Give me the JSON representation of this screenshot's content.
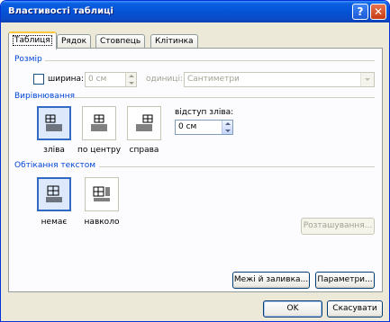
{
  "window": {
    "title": "Властивості таблиці"
  },
  "titlebar": {
    "help_glyph": "?",
    "close_glyph": "✕"
  },
  "tabs": [
    {
      "label": "Таблиця",
      "active": true
    },
    {
      "label": "Рядок",
      "active": false
    },
    {
      "label": "Стовпець",
      "active": false
    },
    {
      "label": "Клітинка",
      "active": false
    }
  ],
  "size": {
    "group": "Розмір",
    "width_label": "ширина:",
    "width_value": "0 см",
    "units_label": "одиниці:",
    "units_value": "Сантиметри"
  },
  "alignment": {
    "group": "Вирівнювання",
    "options": [
      {
        "label": "зліва",
        "selected": true
      },
      {
        "label": "по центру",
        "selected": false
      },
      {
        "label": "справа",
        "selected": false
      }
    ],
    "indent_label": "відступ зліва:",
    "indent_value": "0 см"
  },
  "wrapping": {
    "group": "Обтікання текстом",
    "options": [
      {
        "label": "немає",
        "selected": true
      },
      {
        "label": "навколо",
        "selected": false
      }
    ],
    "position_button": "Розташування..."
  },
  "buttons": {
    "borders": "Межі й заливка...",
    "options": "Параметри...",
    "ok": "OK",
    "cancel": "Скасувати"
  },
  "colors": {
    "group_label": "#0046d5",
    "selection_border": "#316ac5",
    "titlebar": "#0553d6"
  }
}
